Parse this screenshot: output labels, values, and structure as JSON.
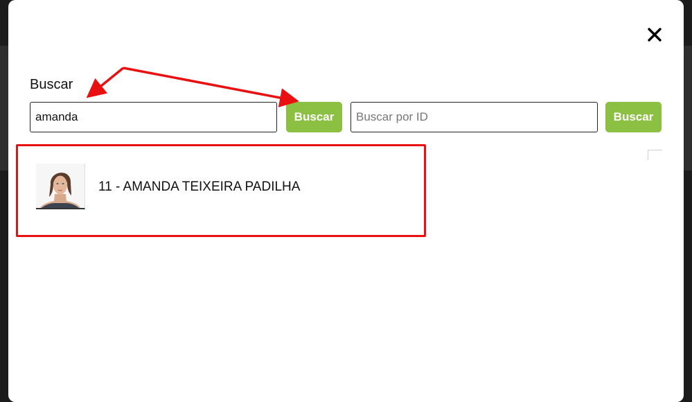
{
  "modal": {
    "close_glyph": "✕",
    "search_label": "Buscar",
    "name_search": {
      "value": "amanda",
      "button_label": "Buscar"
    },
    "id_search": {
      "placeholder": "Buscar por ID",
      "value": "",
      "button_label": "Buscar"
    }
  },
  "results": [
    {
      "label": "11 - AMANDA TEIXEIRA PADILHA",
      "avatar": "person-photo"
    }
  ],
  "annotations": {
    "color": "#e81010"
  },
  "colors": {
    "button_green": "#8bc043",
    "modal_bg": "#ffffff",
    "backdrop": "#1c1c1c"
  }
}
